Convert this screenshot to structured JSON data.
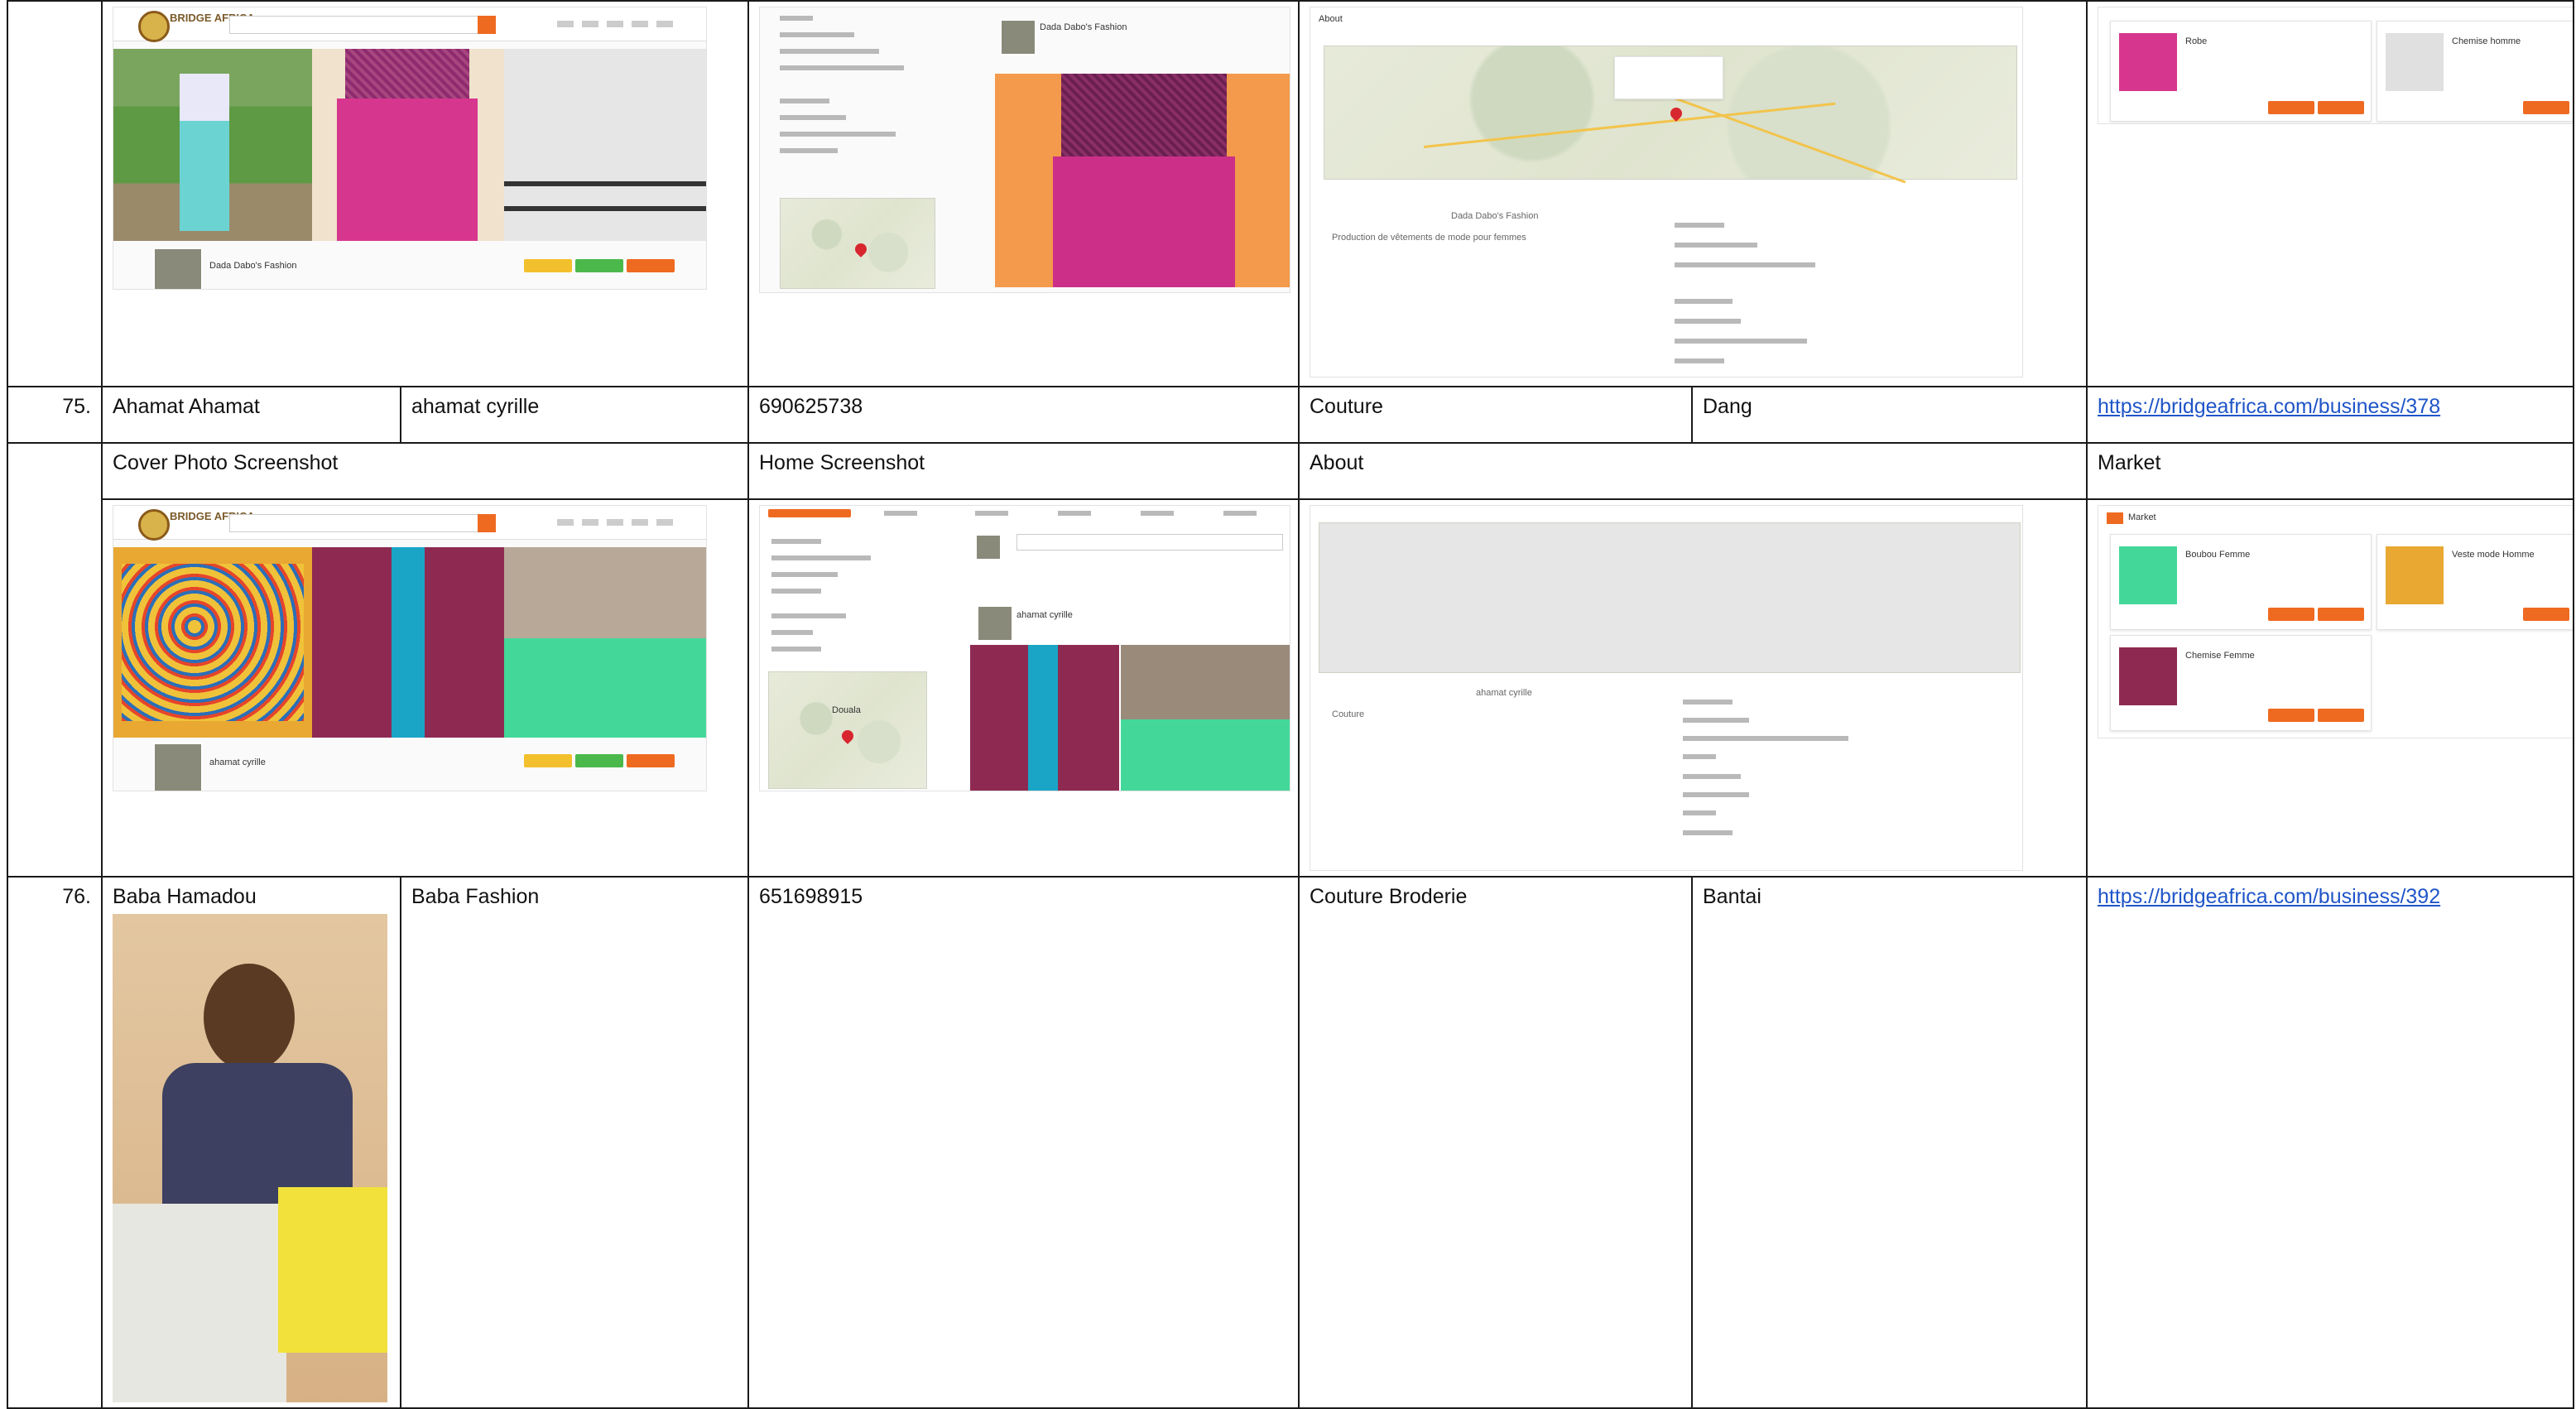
{
  "rows": [
    {
      "number": "75.",
      "name": "Ahamat Ahamat",
      "business": "ahamat cyrille",
      "phone": "690625738",
      "activity": "Couture",
      "location": "Dang",
      "url": "https://bridgeafrica.com/business/378"
    },
    {
      "number": "76.",
      "name": "Baba Hamadou",
      "business": "Baba Fashion",
      "phone": "651698915",
      "activity": "Couture Broderie",
      "location": "Bantai",
      "url": "https://bridgeafrica.com/business/392"
    }
  ],
  "section_headers": {
    "cover": "Cover Photo Screenshot",
    "home": "Home Screenshot",
    "about": "About",
    "market": "Market"
  },
  "shot_texts": {
    "logo": "BRIDGE AFRICA",
    "prev_business": "Dada Dabo's Fashion",
    "prev_about_title": "About",
    "prev_about_desc": "Production de vêtements de mode pour femmes",
    "prev_market_items": [
      "Robe",
      "Chemise homme"
    ],
    "market_title": "Market",
    "market_items": [
      "Boubou Femme",
      "Veste mode Homme",
      "Chemise Femme"
    ],
    "ahamat_label": "ahamat cyrille",
    "about_side": "Couture",
    "map_city": "Douala"
  }
}
